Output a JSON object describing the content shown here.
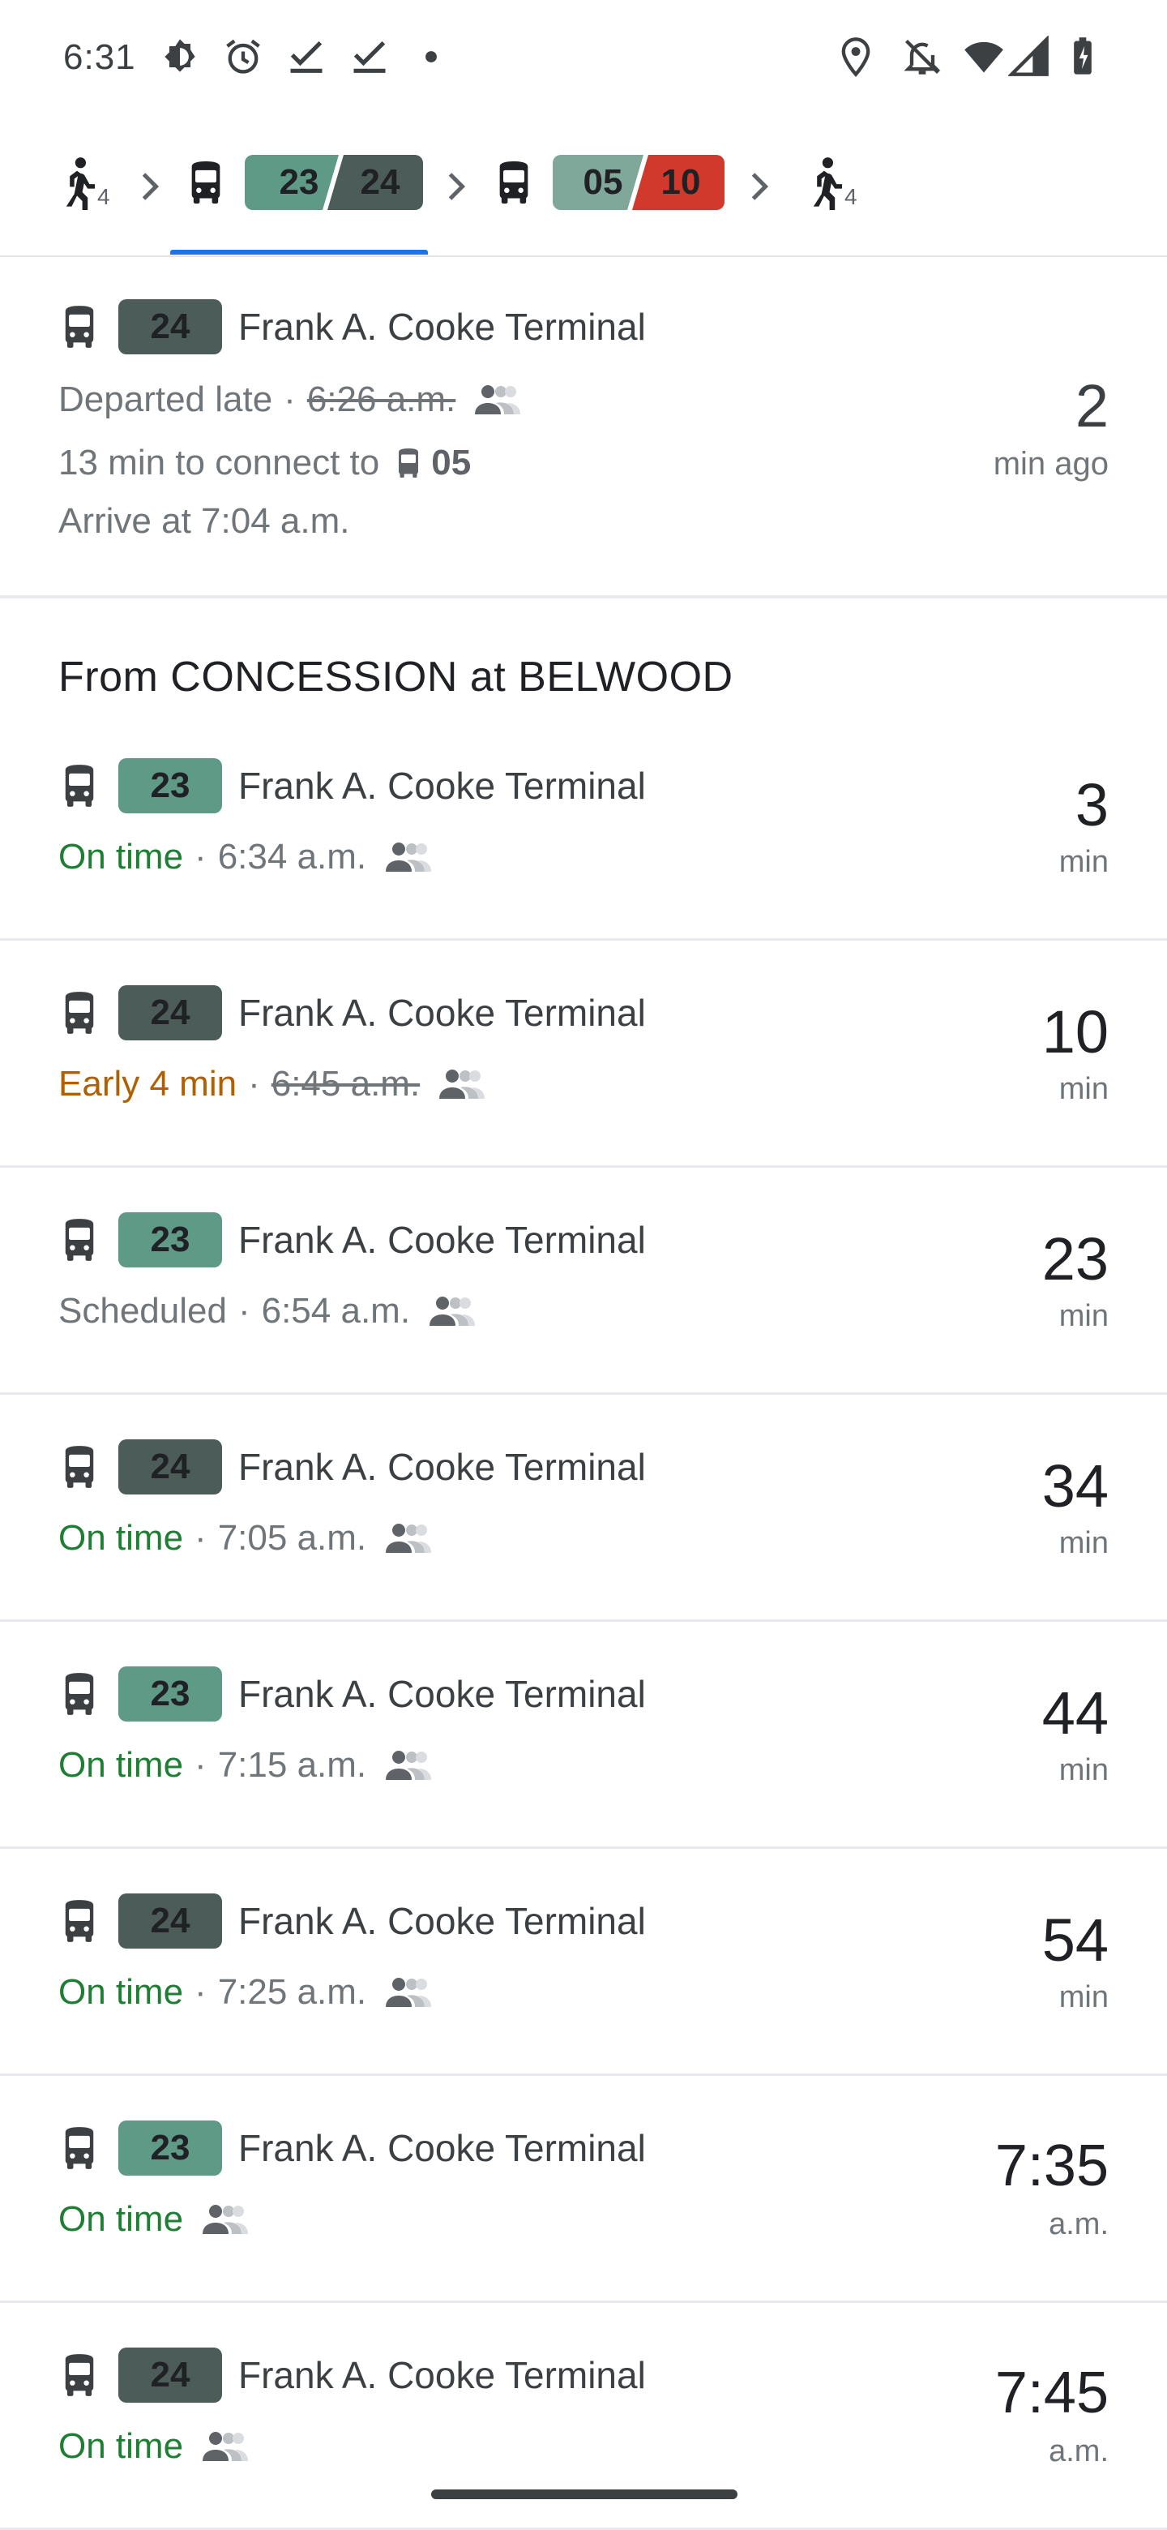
{
  "status_bar": {
    "time": "6:31",
    "icons": [
      "brightness-icon",
      "alarm-icon",
      "check-icon",
      "check-icon",
      "dot-icon",
      "location-icon",
      "notifications-off-icon",
      "wifi-icon",
      "signal-icon",
      "battery-icon"
    ]
  },
  "route": {
    "walk_start_minutes": "4",
    "leg1_a": "23",
    "leg1_b": "24",
    "leg2_a": "05",
    "leg2_b": "10",
    "walk_end_minutes": "4"
  },
  "departed": {
    "route": "24",
    "headsign": "Frank A. Cooke Terminal",
    "status": "Departed late",
    "scheduled_time": "6:26 a.m.",
    "connect_prefix": "13 min to connect to",
    "connect_route": "05",
    "arrive": "Arrive at 7:04 a.m.",
    "ago_value": "2",
    "ago_unit": "min ago"
  },
  "section_title": "From CONCESSION at BELWOOD",
  "departures": [
    {
      "route": "23",
      "headsign": "Frank A. Cooke Terminal",
      "status": "On time",
      "time": "6:34 a.m.",
      "value": "3",
      "unit": "min"
    },
    {
      "route": "24",
      "headsign": "Frank A. Cooke Terminal",
      "status": "Early 4 min",
      "time": "6:45 a.m.",
      "value": "10",
      "unit": "min"
    },
    {
      "route": "23",
      "headsign": "Frank A. Cooke Terminal",
      "status": "Scheduled",
      "time": "6:54 a.m.",
      "value": "23",
      "unit": "min"
    },
    {
      "route": "24",
      "headsign": "Frank A. Cooke Terminal",
      "status": "On time",
      "time": "7:05 a.m.",
      "value": "34",
      "unit": "min"
    },
    {
      "route": "23",
      "headsign": "Frank A. Cooke Terminal",
      "status": "On time",
      "time": "7:15 a.m.",
      "value": "44",
      "unit": "min"
    },
    {
      "route": "24",
      "headsign": "Frank A. Cooke Terminal",
      "status": "On time",
      "time": "7:25 a.m.",
      "value": "54",
      "unit": "min"
    },
    {
      "route": "23",
      "headsign": "Frank A. Cooke Terminal",
      "status": "On time",
      "time": "",
      "value": "7:35",
      "unit": "a.m."
    },
    {
      "route": "24",
      "headsign": "Frank A. Cooke Terminal",
      "status": "On time",
      "time": "",
      "value": "7:45",
      "unit": "a.m."
    }
  ],
  "colors": {
    "route_23": "#5e9a85",
    "route_24": "#4b5c59",
    "route_05": "#7fa89a",
    "route_10": "#d0392b",
    "on_time": "#1e7e34",
    "early": "#b06000",
    "tab_indicator": "#1a73e8"
  }
}
